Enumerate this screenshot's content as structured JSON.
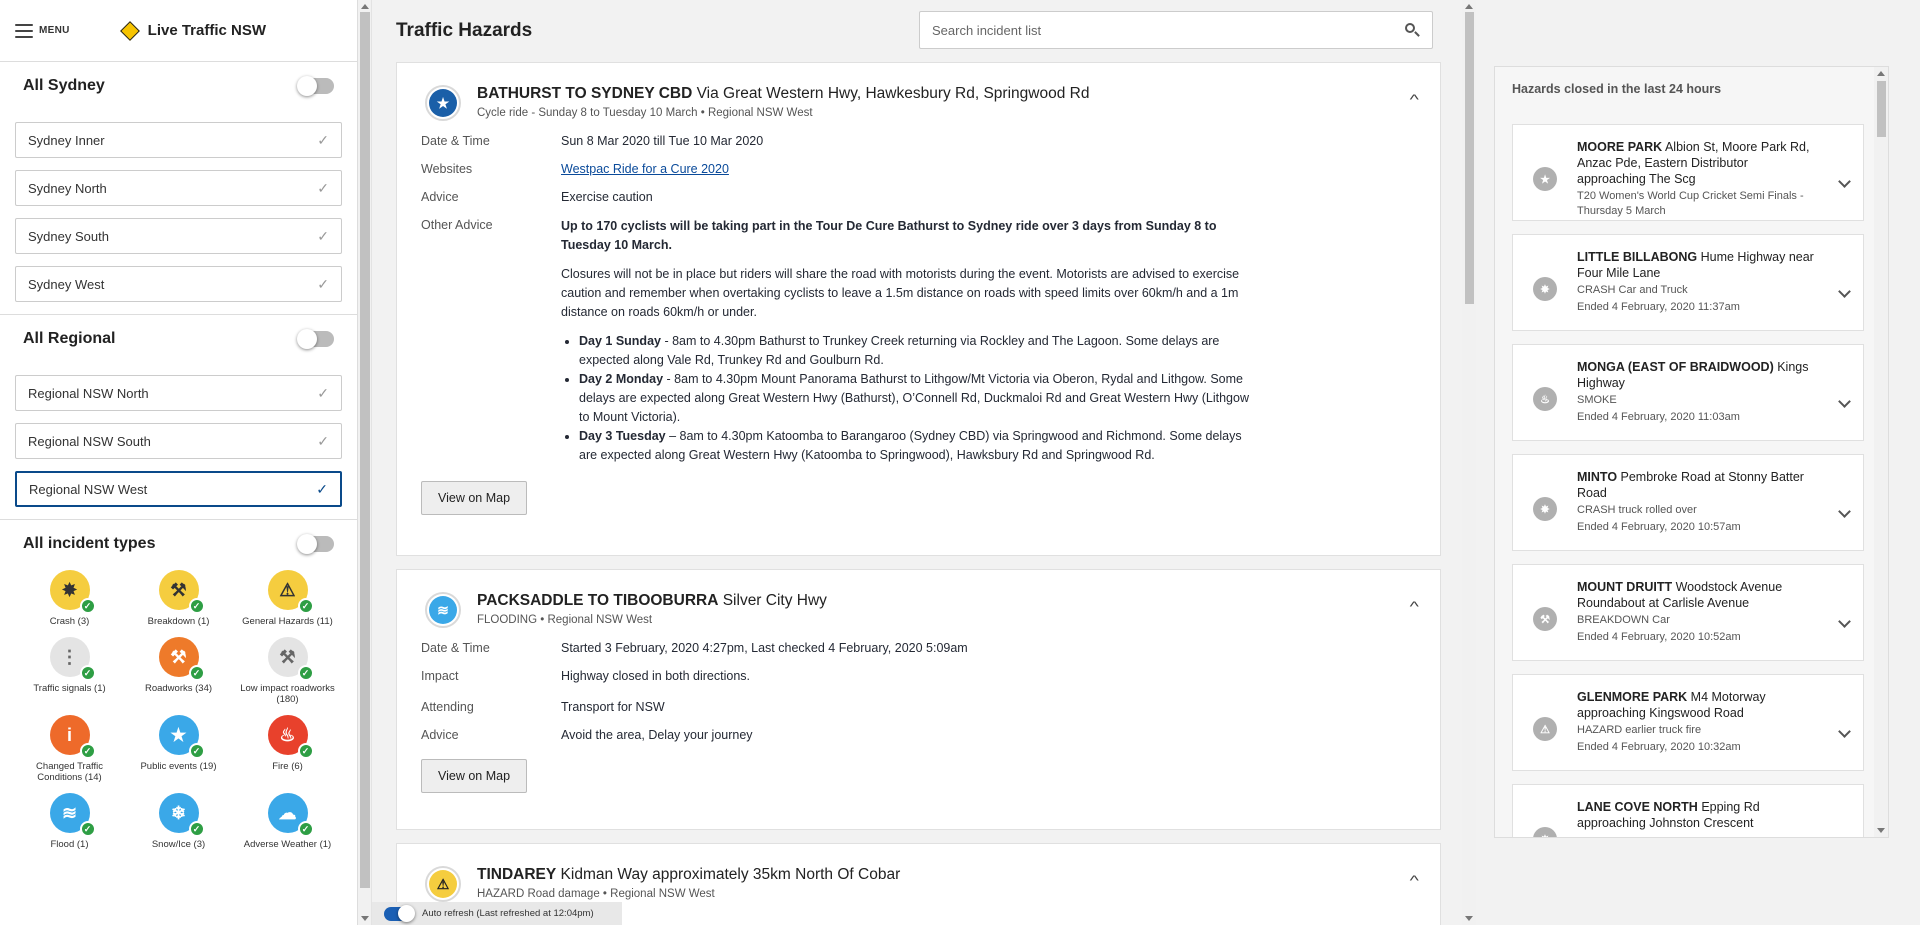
{
  "sidebar": {
    "menu_label": "MENU",
    "brand": "Live Traffic NSW",
    "sydney": {
      "title": "All Sydney",
      "regions": [
        "Sydney Inner",
        "Sydney North",
        "Sydney South",
        "Sydney West"
      ]
    },
    "regional": {
      "title": "All Regional",
      "regions": [
        "Regional NSW North",
        "Regional NSW South",
        "Regional NSW West"
      ],
      "selected": "Regional NSW West"
    },
    "types": {
      "title": "All incident types",
      "items": [
        {
          "label": "Crash  (3)",
          "icon": "crash-icon",
          "color": "#f5cd3f",
          "glyph": "✸"
        },
        {
          "label": "Breakdown (1)",
          "icon": "breakdown-icon",
          "color": "#f5cd3f",
          "glyph": "⚒"
        },
        {
          "label": "General Hazards  (11)",
          "icon": "hazard-icon",
          "color": "#f5cd3f",
          "glyph": "⚠"
        },
        {
          "label": "Traffic signals  (1)",
          "icon": "traffic-signals-icon",
          "color": "#e4e4e4",
          "glyph": "⋮"
        },
        {
          "label": "Roadworks  (34)",
          "icon": "roadworks-icon",
          "color": "#ee7a2a",
          "glyph": "⚒"
        },
        {
          "label": "Low impact roadworks (180)",
          "icon": "low-impact-roadworks-icon",
          "color": "#e4e4e4",
          "glyph": "⚒"
        },
        {
          "label": "Changed Traffic Conditions  (14)",
          "icon": "changed-conditions-icon",
          "color": "#ee6a2a",
          "glyph": "i"
        },
        {
          "label": "Public events  (19)",
          "icon": "public-events-icon",
          "color": "#3aa8e8",
          "glyph": "★"
        },
        {
          "label": "Fire  (6)",
          "icon": "fire-icon",
          "color": "#e8412c",
          "glyph": "♨"
        },
        {
          "label": "Flood  (1)",
          "icon": "flood-icon",
          "color": "#3aa8e8",
          "glyph": "≋"
        },
        {
          "label": "Snow/Ice  (3)",
          "icon": "snow-icon",
          "color": "#3aa8e8",
          "glyph": "❄"
        },
        {
          "label": "Adverse Weather  (1)",
          "icon": "weather-icon",
          "color": "#3aa8e8",
          "glyph": "☁"
        }
      ]
    }
  },
  "main": {
    "title": "Traffic Hazards",
    "search_placeholder": "Search incident list",
    "auto_refresh": "Auto refresh (Last refreshed at 12:04pm)",
    "view_map_label": "View on Map",
    "cards": [
      {
        "title_bold": "BATHURST TO SYDNEY CBD",
        "title_rest": " Via Great Western Hwy, Hawkesbury Rd, Springwood Rd",
        "subtitle": "Cycle ride - Sunday 8 to Tuesday 10 March • Regional NSW West",
        "icon_color": "#1a5fa8",
        "glyph": "★",
        "date_label": "Date & Time",
        "date_value": "Sun 8 Mar 2020 till Tue 10 Mar 2020",
        "websites_label": "Websites",
        "websites_value": "Westpac Ride for a Cure 2020",
        "advice_label": "Advice",
        "advice_value": "Exercise caution",
        "other_label": "Other Advice",
        "other_bold": "Up to 170 cyclists  will be taking part in the Tour De Cure Bathurst to Sydney ride over 3 days from Sunday 8 to Tuesday 10 March.",
        "other_para": "Closures will not be in place but riders will share the road with motorists during the event. Motorists are advised to exercise caution and remember when overtaking cyclists to leave a 1.5m distance on roads with speed limits over 60km/h and a 1m distance on roads 60km/h or under.",
        "days": [
          {
            "day": "Day 1 Sunday",
            "text": "  - 8am to 4.30pm Bathurst to Trunkey Creek returning via Rockley and The Lagoon. Some delays are expected along Vale Rd, Trunkey Rd and Goulburn Rd."
          },
          {
            "day": "Day 2  Monday",
            "text": " - 8am to 4.30pm Mount Panorama Bathurst to Lithgow/Mt Victoria via Oberon, Rydal and Lithgow. Some delays are expected along Great Western Hwy (Bathurst), O’Connell Rd, Duckmaloi Rd and Great Western Hwy (Lithgow to Mount Victoria)."
          },
          {
            "day": "Day 3  Tuesday",
            "text": " – 8am to 4.30pm Katoomba to Barangaroo (Sydney CBD) via Springwood and Richmond.  Some delays are expected along  Great Western Hwy (Katoomba to Springwood), Hawksbury Rd and Springwood Rd."
          }
        ]
      },
      {
        "title_bold": "PACKSADDLE TO TIBOOBURRA",
        "title_rest": " Silver City Hwy",
        "subtitle": "FLOODING • Regional NSW West",
        "icon_color": "#3aa8e8",
        "glyph": "≋",
        "date_label": "Date & Time",
        "date_value": "Started 3 February, 2020 4:27pm, Last checked 4 February, 2020 5:09am",
        "impact_label": "Impact",
        "impact_value": "Highway closed in both directions.",
        "attending_label": "Attending",
        "attending_value": "Transport for NSW",
        "advice_label": "Advice",
        "advice_value": "Avoid the area, Delay your journey"
      },
      {
        "title_bold": "TINDAREY",
        "title_rest": " Kidman Way approximately 35km North Of Cobar",
        "subtitle": "HAZARD Road damage • Regional NSW West",
        "icon_color": "#f5cd3f",
        "glyph": "⚠"
      }
    ]
  },
  "closed": {
    "title": "Hazards closed in the last 24 hours",
    "items": [
      {
        "bold": "MOORE PARK",
        "rest": " Albion St, Moore Park Rd, Anzac Pde, Eastern Distributor approaching The Scg",
        "l1": "T20 Women's World Cup Cricket Semi Finals - Thursday 5 March",
        "l2": "",
        "glyph": "★",
        "icon": "event-icon"
      },
      {
        "bold": "LITTLE BILLABONG",
        "rest": " Hume Highway near Four Mile Lane",
        "l1": "CRASH Car and Truck",
        "l2": "Ended 4 February, 2020 11:37am",
        "glyph": "✸",
        "icon": "crash-icon"
      },
      {
        "bold": "MONGA (EAST OF BRAIDWOOD)",
        "rest": " Kings Highway",
        "l1": "SMOKE",
        "l2": "Ended 4 February, 2020 11:03am",
        "glyph": "♨",
        "icon": "fire-icon"
      },
      {
        "bold": "MINTO",
        "rest": " Pembroke Road at Stonny Batter Road",
        "l1": "CRASH truck rolled over",
        "l2": "Ended 4 February, 2020 10:57am",
        "glyph": "✸",
        "icon": "crash-icon"
      },
      {
        "bold": "MOUNT DRUITT",
        "rest": " Woodstock Avenue Roundabout at Carlisle Avenue",
        "l1": "BREAKDOWN Car",
        "l2": "Ended 4 February, 2020 10:52am",
        "glyph": "⚒",
        "icon": "breakdown-icon"
      },
      {
        "bold": "GLENMORE PARK",
        "rest": " M4 Motorway approaching Kingswood Road",
        "l1": "HAZARD earlier truck fire",
        "l2": "Ended 4 February, 2020 10:32am",
        "glyph": "⚠",
        "icon": "hazard-icon"
      },
      {
        "bold": "LANE COVE NORTH",
        "rest": " Epping Rd approaching Johnston Crescent",
        "l1": "",
        "l2": "",
        "glyph": "✸",
        "icon": "crash-icon"
      }
    ]
  }
}
